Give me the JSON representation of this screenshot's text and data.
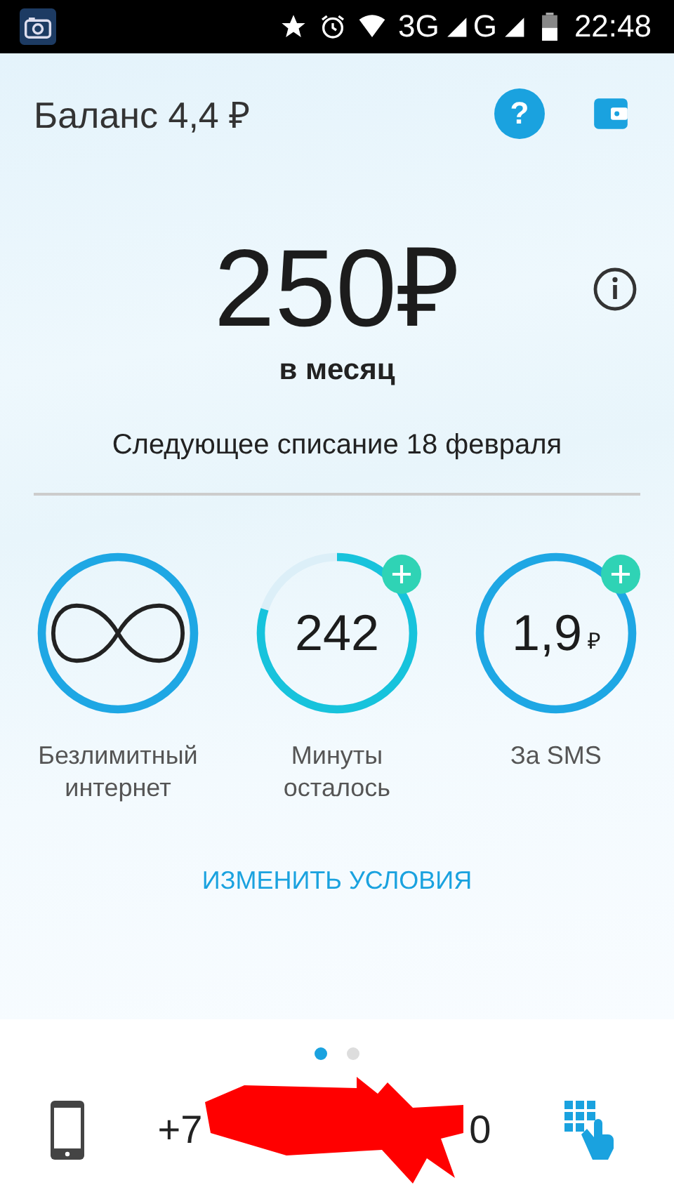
{
  "status_bar": {
    "network_1": "3G",
    "network_2": "G",
    "time": "22:48"
  },
  "header": {
    "balance": "Баланс 4,4 ₽",
    "help_label": "?"
  },
  "tariff": {
    "price": "250₽",
    "period": "в месяц",
    "next_charge": "Следующее списание 18 февраля"
  },
  "counters": [
    {
      "kind": "unlimited",
      "label": "Безлимитный интернет",
      "add_button": false
    },
    {
      "kind": "minutes",
      "value": "242",
      "label": "Минуты осталось",
      "add_button": true
    },
    {
      "kind": "money",
      "value": "1,9",
      "currency": "₽",
      "label": "За SMS",
      "add_button": true
    }
  ],
  "change_link": "ИЗМЕНИТЬ УСЛОВИЯ",
  "pager": [
    {
      "selected": true
    },
    {
      "selected": false
    }
  ],
  "phone": {
    "visible_start": "+7",
    "visible_end": "0"
  }
}
